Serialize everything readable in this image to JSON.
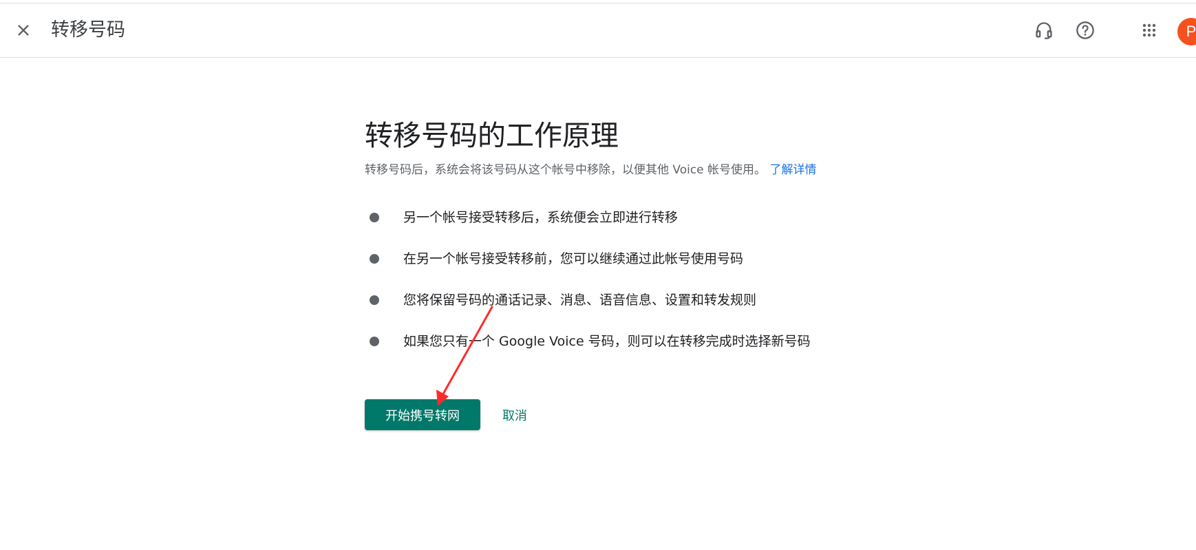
{
  "header": {
    "title": "转移号码",
    "avatar_letter": "P",
    "avatar_color": "#f4511e"
  },
  "icons": {
    "close": "close-icon",
    "support": "headset-icon",
    "help": "help-circle-icon",
    "apps": "apps-grid-icon"
  },
  "main": {
    "heading": "转移号码的工作原理",
    "subtitle": "转移号码后，系统会将该号码从这个帐号中移除，以便其他 Voice 帐号使用。",
    "learn_more": "了解详情",
    "bullets": [
      "另一个帐号接受转移后，系统便会立即进行转移",
      "在另一个帐号接受转移前，您可以继续通过此帐号使用号码",
      "您将保留号码的通话记录、消息、语音信息、设置和转发规则",
      "如果您只有一个 Google Voice 号码，则可以在转移完成时选择新号码"
    ]
  },
  "actions": {
    "primary_label": "开始携号转网",
    "cancel_label": "取消"
  },
  "colors": {
    "accent": "#00796b",
    "link": "#1a73e8",
    "annotation": "#ff2b2b"
  }
}
